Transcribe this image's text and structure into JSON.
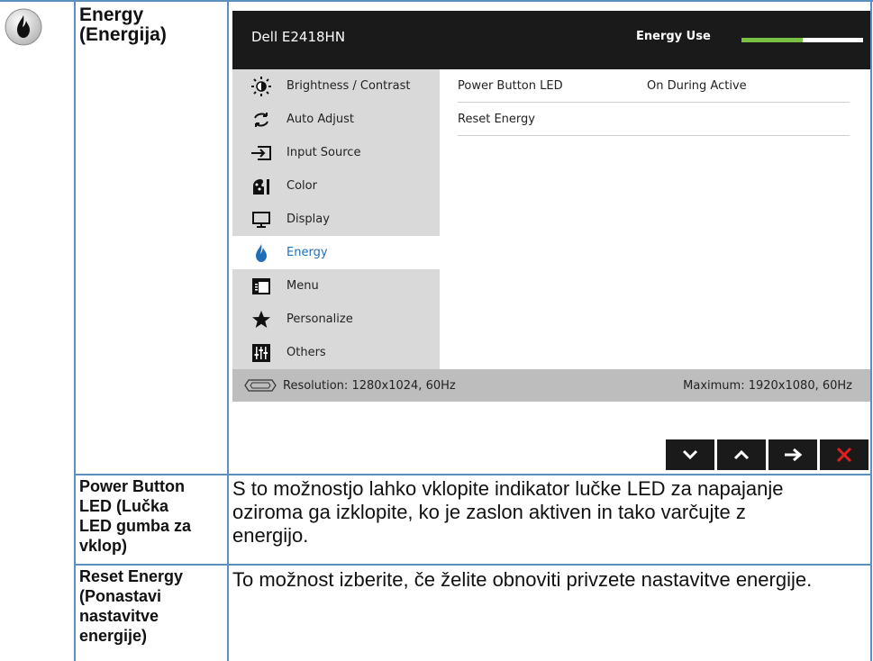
{
  "section": {
    "title_line1": "Energy",
    "title_line2": "(Energija)"
  },
  "osd": {
    "model": "Dell E2418HN",
    "energy_use_label": "Energy Use",
    "energy_use_level": 0.5,
    "colors": {
      "energy_bar": "#7ac143",
      "active_menu": "#1e6fb8",
      "close_button": "#e02020"
    },
    "menu": [
      {
        "label": "Brightness / Contrast",
        "icon": "brightness-icon"
      },
      {
        "label": "Auto Adjust",
        "icon": "auto-adjust-icon"
      },
      {
        "label": "Input Source",
        "icon": "input-source-icon"
      },
      {
        "label": "Color",
        "icon": "color-icon"
      },
      {
        "label": "Display",
        "icon": "display-icon"
      },
      {
        "label": "Energy",
        "icon": "energy-icon",
        "active": true
      },
      {
        "label": "Menu",
        "icon": "menu-icon"
      },
      {
        "label": "Personalize",
        "icon": "star-icon"
      },
      {
        "label": "Others",
        "icon": "others-icon"
      }
    ],
    "settings": [
      {
        "label": "Power Button LED",
        "value": "On During Active"
      },
      {
        "label": "Reset Energy",
        "value": ""
      }
    ],
    "status": {
      "resolution": "Resolution: 1280x1024, 60Hz",
      "maximum": "Maximum: 1920x1080, 60Hz"
    },
    "buttons": [
      "down-button",
      "up-button",
      "enter-button",
      "close-button"
    ]
  },
  "rows": [
    {
      "label_lines": [
        "Power Button",
        "LED (Lučka",
        "LED gumba za",
        "vklop)"
      ],
      "desc_lines": [
        "S to možnostjo lahko vklopite indikator lučke LED za napajanje",
        "oziroma ga izklopite, ko je zaslon aktiven in tako varčujte z",
        "energijo."
      ]
    },
    {
      "label_lines": [
        "Reset Energy",
        "(Ponastavi",
        "nastavitve",
        "energije)"
      ],
      "desc_lines": [
        "To možnost izberite, če želite obnoviti privzete nastavitve energije."
      ]
    }
  ]
}
